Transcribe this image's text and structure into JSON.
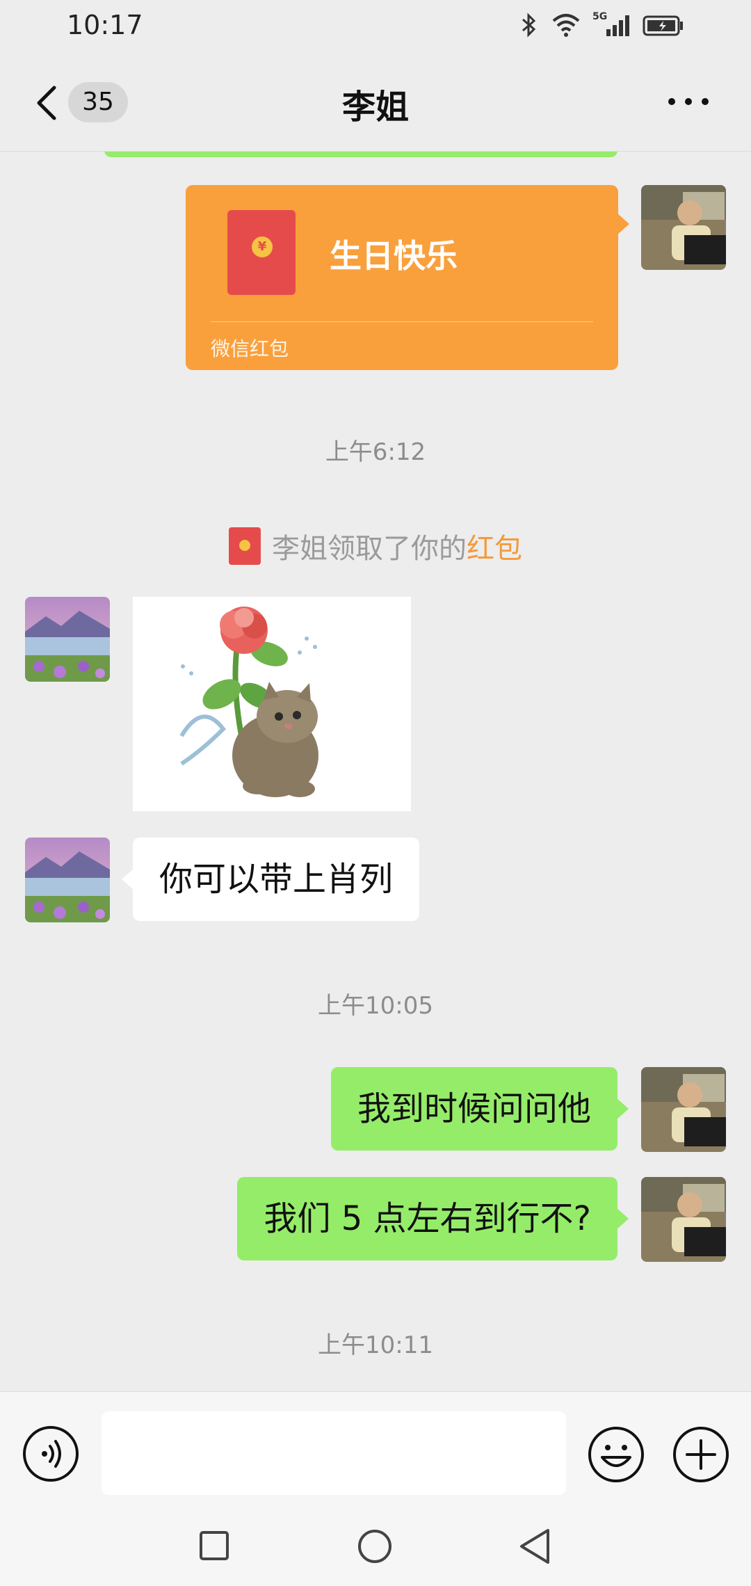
{
  "status_bar": {
    "time": "10:17",
    "network_label": "5G"
  },
  "header": {
    "back_count": "35",
    "title": "李姐"
  },
  "messages": {
    "red_packet": {
      "title": "生日快乐",
      "footer": "微信红包",
      "coin_symbol": "¥"
    },
    "timestamp_1": "上午6:12",
    "system_notice": {
      "text": "李姐领取了你的",
      "highlight": "红包"
    },
    "incoming_text": "你可以带上肖列",
    "timestamp_2": "上午10:05",
    "outgoing_1": "我到时候问问他",
    "outgoing_2": "我们 5 点左右到行不?",
    "timestamp_3": "上午10:11"
  },
  "input": {
    "value": "",
    "placeholder": ""
  },
  "colors": {
    "accent_green": "#95ec69",
    "red_packet_orange": "#f9a03d",
    "red_packet_red": "#e64b4b",
    "highlight_orange": "#f39b3b",
    "background": "#ededed"
  },
  "icons": [
    "back-arrow-icon",
    "more-dots-icon",
    "red-packet-icon",
    "voice-icon",
    "emoji-icon",
    "plus-icon",
    "nav-recents-icon",
    "nav-home-icon",
    "nav-back-icon"
  ]
}
